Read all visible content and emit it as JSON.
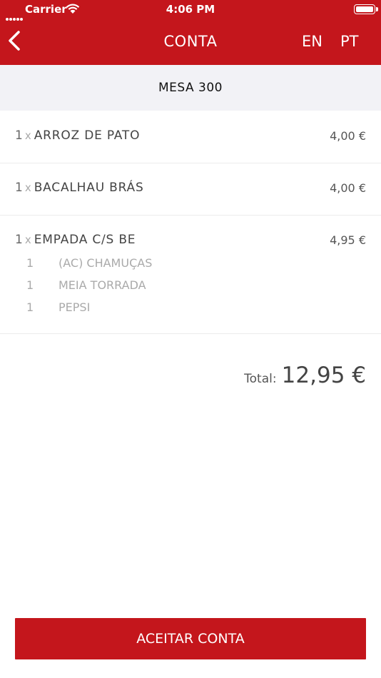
{
  "status_bar": {
    "carrier": "Carrier",
    "time": "4:06 PM"
  },
  "nav": {
    "title": "CONTA",
    "lang_en": "EN",
    "lang_pt": "PT"
  },
  "table": {
    "label": "MESA 300"
  },
  "items": [
    {
      "qty": "1",
      "x": "x",
      "name": "ARROZ DE PATO",
      "price": "4,00 €"
    },
    {
      "qty": "1",
      "x": "x",
      "name": "BACALHAU BRÁS",
      "price": "4,00 €"
    },
    {
      "qty": "1",
      "x": "x",
      "name": "EMPADA C/S BE",
      "price": "4,95 €",
      "sub_items": [
        {
          "qty": "1",
          "name": "(AC) CHAMUÇAS"
        },
        {
          "qty": "1",
          "name": "MEIA TORRADA"
        },
        {
          "qty": "1",
          "name": "PEPSI"
        }
      ]
    }
  ],
  "total": {
    "label": "Total:",
    "value": "12,95 €"
  },
  "accept_button": {
    "label": "ACEITAR CONTA"
  },
  "colors": {
    "brand": "#c4161c",
    "table_bar_bg": "#f2f2f6"
  },
  "icons": {
    "back": "chevron-left-icon",
    "wifi": "wifi-icon",
    "battery": "battery-icon",
    "signal": "signal-dots-icon"
  }
}
